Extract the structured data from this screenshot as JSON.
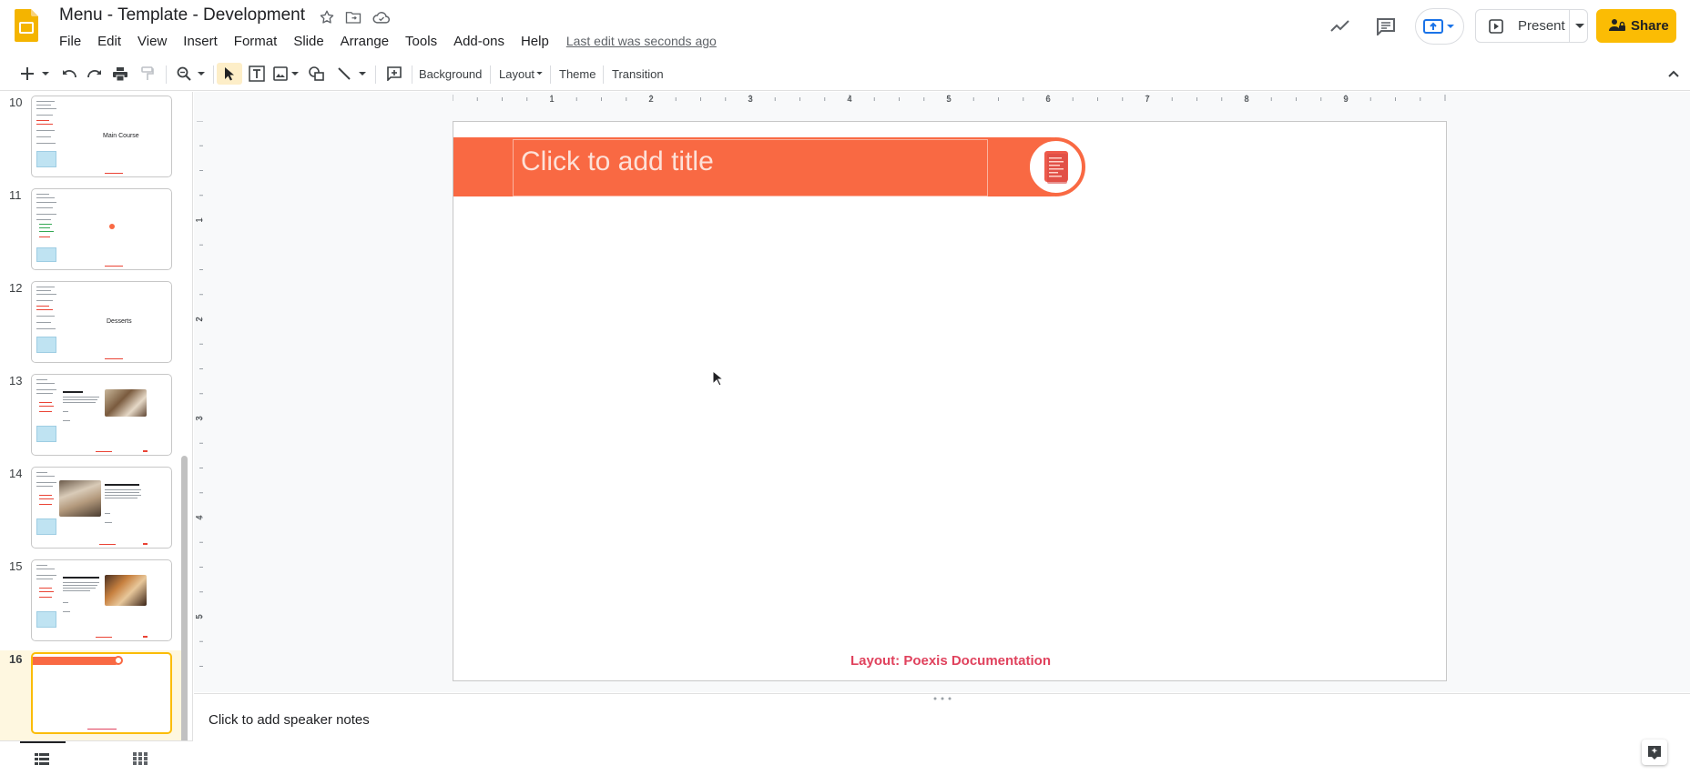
{
  "app": {
    "doc_title": "Menu - Template - Development",
    "last_edit": "Last edit was seconds ago",
    "colors": {
      "accent_yellow": "#fbbc04",
      "slides_logo": "#f4b400",
      "title_bar": "#f96943",
      "footer_text": "#e0425d"
    }
  },
  "menubar": {
    "items": [
      "File",
      "Edit",
      "View",
      "Insert",
      "Format",
      "Slide",
      "Arrange",
      "Tools",
      "Add-ons",
      "Help"
    ]
  },
  "header_right": {
    "present_label": "Present",
    "share_label": "Share"
  },
  "toolbar": {
    "background_label": "Background",
    "layout_label": "Layout",
    "theme_label": "Theme",
    "transition_label": "Transition"
  },
  "filmstrip": {
    "slides": [
      {
        "number": "10",
        "center_text": "Main Course"
      },
      {
        "number": "11",
        "center_text": ""
      },
      {
        "number": "12",
        "center_text": "Desserts"
      },
      {
        "number": "13",
        "center_text": ""
      },
      {
        "number": "14",
        "center_text": ""
      },
      {
        "number": "15",
        "center_text": ""
      },
      {
        "number": "16",
        "center_text": "",
        "selected": true
      }
    ]
  },
  "ruler": {
    "top_numbers": [
      "1",
      "2",
      "3",
      "4",
      "5",
      "6",
      "7",
      "8",
      "9"
    ],
    "left_numbers": [
      "1",
      "2",
      "3",
      "4",
      "5"
    ]
  },
  "slide": {
    "title_placeholder": "Click to add title",
    "footer": "Layout: Poexis Documentation"
  },
  "notes": {
    "placeholder": "Click to add speaker notes"
  }
}
